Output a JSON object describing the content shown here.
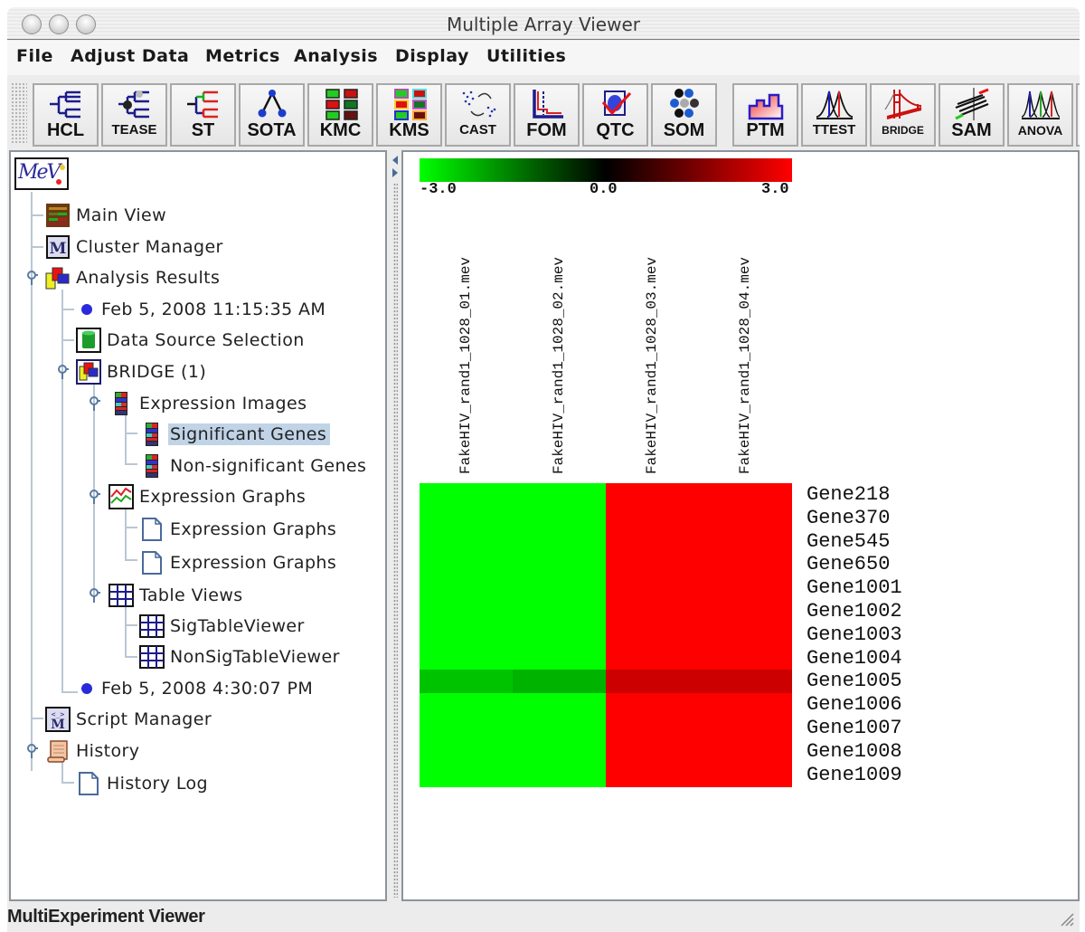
{
  "window": {
    "title": "Multiple Array Viewer"
  },
  "menubar": {
    "items": [
      "File",
      "Adjust Data",
      "Metrics",
      "Analysis",
      "Display",
      "Utilities"
    ]
  },
  "toolbar": {
    "buttons": [
      {
        "label": "HCL",
        "icon": "hierarchical-clustering-icon"
      },
      {
        "label": "TEASE",
        "icon": "tease-tree-icon"
      },
      {
        "label": "ST",
        "icon": "support-tree-icon"
      },
      {
        "label": "SOTA",
        "icon": "sota-tree-icon"
      },
      {
        "label": "KMC",
        "icon": "kmeans-cluster-icon"
      },
      {
        "label": "KMS",
        "icon": "kmeans-support-icon"
      },
      {
        "label": "CAST",
        "icon": "cast-scatter-icon"
      },
      {
        "label": "FOM",
        "icon": "figure-of-merit-icon"
      },
      {
        "label": "QTC",
        "icon": "qt-cluster-icon"
      },
      {
        "label": "SOM",
        "icon": "self-organizing-map-icon"
      },
      {
        "label": "PTM",
        "icon": "template-matching-icon"
      },
      {
        "label": "TTEST",
        "icon": "ttest-distribution-icon"
      },
      {
        "label": "BRIDGE",
        "icon": "bridge-icon"
      },
      {
        "label": "SAM",
        "icon": "sam-plot-icon"
      },
      {
        "label": "ANOVA",
        "icon": "anova-distribution-icon"
      }
    ]
  },
  "tree": {
    "logo": "MeV",
    "nodes": [
      {
        "label": "Main View",
        "icon": "main-view-icon"
      },
      {
        "label": "Cluster Manager",
        "icon": "cluster-manager-icon"
      },
      {
        "label": "Analysis Results",
        "icon": "analysis-results-icon",
        "expanded": true
      },
      {
        "label": "Feb 5, 2008 11:15:35 AM",
        "icon": "bullet-icon"
      },
      {
        "label": "Data Source Selection",
        "icon": "database-icon"
      },
      {
        "label": "BRIDGE (1)",
        "icon": "analysis-results-icon",
        "expanded": true
      },
      {
        "label": "Expression Images",
        "icon": "expression-image-icon",
        "expanded": true
      },
      {
        "label": "Significant Genes",
        "icon": "expression-image-icon",
        "selected": true
      },
      {
        "label": "Non-significant Genes",
        "icon": "expression-image-icon"
      },
      {
        "label": "Expression Graphs",
        "icon": "expression-graph-icon",
        "expanded": true
      },
      {
        "label": "Expression Graphs",
        "icon": "document-icon"
      },
      {
        "label": "Expression Graphs",
        "icon": "document-icon"
      },
      {
        "label": "Table Views",
        "icon": "table-icon",
        "expanded": true
      },
      {
        "label": "SigTableViewer",
        "icon": "table-icon"
      },
      {
        "label": "NonSigTableViewer",
        "icon": "table-icon"
      },
      {
        "label": "Feb 5, 2008 4:30:07 PM",
        "icon": "bullet-icon"
      },
      {
        "label": "Script Manager",
        "icon": "script-manager-icon"
      },
      {
        "label": "History",
        "icon": "history-scroll-icon",
        "expanded": true
      },
      {
        "label": "History Log",
        "icon": "document-icon"
      }
    ]
  },
  "chart_data": {
    "type": "heatmap",
    "title": "Significant Genes",
    "color_scale": {
      "min": -3.0,
      "mid": 0.0,
      "max": 3.0,
      "min_label": "-3.0",
      "mid_label": "0.0",
      "max_label": "3.0",
      "min_color": "#00ff00",
      "mid_color": "#000000",
      "max_color": "#ff0000"
    },
    "columns": [
      "FakeHIV_rand1_1028_01.mev",
      "FakeHIV_rand1_1028_02.mev",
      "FakeHIV_rand1_1028_03.mev",
      "FakeHIV_rand1_1028_04.mev"
    ],
    "rows": [
      "Gene218",
      "Gene370",
      "Gene545",
      "Gene650",
      "Gene1001",
      "Gene1002",
      "Gene1003",
      "Gene1004",
      "Gene1005",
      "Gene1006",
      "Gene1007",
      "Gene1008",
      "Gene1009"
    ],
    "values": [
      [
        -3.0,
        -3.0,
        3.0,
        3.0
      ],
      [
        -3.0,
        -3.0,
        3.0,
        3.0
      ],
      [
        -3.0,
        -3.0,
        3.0,
        3.0
      ],
      [
        -3.0,
        -3.0,
        3.0,
        3.0
      ],
      [
        -3.0,
        -3.0,
        3.0,
        3.0
      ],
      [
        -3.0,
        -3.0,
        3.0,
        3.0
      ],
      [
        -3.0,
        -3.0,
        3.0,
        3.0
      ],
      [
        -3.0,
        -3.0,
        3.0,
        3.0
      ],
      [
        -2.3,
        -2.1,
        2.4,
        2.4
      ],
      [
        -3.0,
        -3.0,
        3.0,
        3.0
      ],
      [
        -3.0,
        -3.0,
        3.0,
        3.0
      ],
      [
        -3.0,
        -3.0,
        3.0,
        3.0
      ],
      [
        -3.0,
        -3.0,
        3.0,
        3.0
      ]
    ]
  },
  "statusbar": {
    "text": "MultiExperiment Viewer"
  }
}
